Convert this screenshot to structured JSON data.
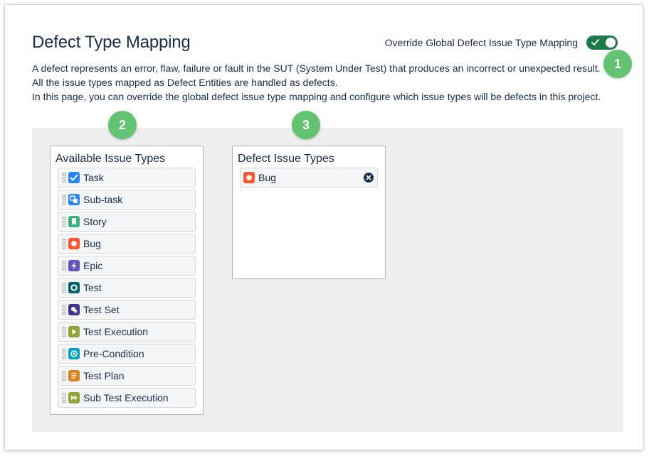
{
  "header": {
    "title": "Defect Type Mapping",
    "override_label": "Override Global Defect Issue Type Mapping",
    "override_enabled": true
  },
  "description": {
    "line1": "A defect represents an error, flaw, failure or fault in the SUT (System Under Test) that produces an incorrect or unexpected result. All the issue types mapped as Defect Entities are handled as defects.",
    "line2": "In this page, you can override the global defect issue type mapping and configure which issue types will be defects in this project."
  },
  "badges": {
    "one": "1",
    "two": "2",
    "three": "3"
  },
  "available": {
    "title": "Available Issue Types",
    "items": [
      {
        "label": "Task",
        "icon": "task-icon",
        "color": "#2684ff"
      },
      {
        "label": "Sub-task",
        "icon": "subtask-icon",
        "color": "#2684ff"
      },
      {
        "label": "Story",
        "icon": "story-icon",
        "color": "#36b37e"
      },
      {
        "label": "Bug",
        "icon": "bug-icon",
        "color": "#ff5630"
      },
      {
        "label": "Epic",
        "icon": "epic-icon",
        "color": "#6554c0"
      },
      {
        "label": "Test",
        "icon": "test-icon",
        "color": "#00636b"
      },
      {
        "label": "Test Set",
        "icon": "test-set-icon",
        "color": "#403294"
      },
      {
        "label": "Test Execution",
        "icon": "test-execution-icon",
        "color": "#8fa533"
      },
      {
        "label": "Pre-Condition",
        "icon": "pre-condition-icon",
        "color": "#00a3bf"
      },
      {
        "label": "Test Plan",
        "icon": "test-plan-icon",
        "color": "#e0821a"
      },
      {
        "label": "Sub Test Execution",
        "icon": "sub-test-execution-icon",
        "color": "#8fa533"
      }
    ]
  },
  "defect": {
    "title": "Defect Issue Types",
    "items": [
      {
        "label": "Bug",
        "icon": "bug-icon",
        "color": "#ff5630"
      }
    ]
  },
  "colors": {
    "toggle_on": "#1f7a4a",
    "badge": "#62c370",
    "panel_bg": "#eeeeee"
  }
}
